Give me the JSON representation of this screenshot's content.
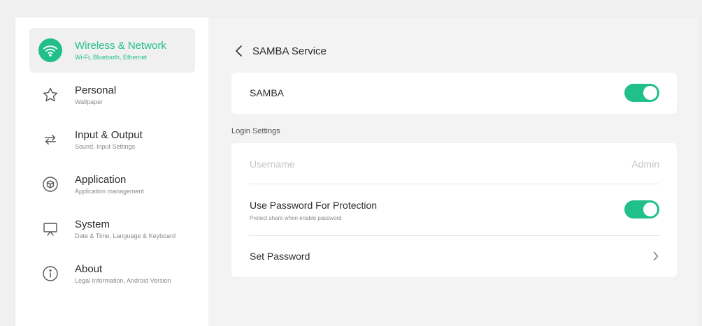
{
  "sidebar": {
    "items": [
      {
        "title": "Wireless & Network",
        "subtitle": "Wi-Fi, Bluetooth, Ethernet",
        "icon": "wifi-icon",
        "active": true
      },
      {
        "title": "Personal",
        "subtitle": "Wallpaper",
        "icon": "star-icon",
        "active": false
      },
      {
        "title": "Input & Output",
        "subtitle": "Sound, Input Settings",
        "icon": "arrows-swap-icon",
        "active": false
      },
      {
        "title": "Application",
        "subtitle": "Application management",
        "icon": "cube-icon",
        "active": false
      },
      {
        "title": "System",
        "subtitle": "Date & Time, Language & Keyboard",
        "icon": "monitor-icon",
        "active": false
      },
      {
        "title": "About",
        "subtitle": "Legal Information, Android Version",
        "icon": "info-icon",
        "active": false
      }
    ]
  },
  "header": {
    "title": "SAMBA Service"
  },
  "samba": {
    "label": "SAMBA",
    "enabled": true
  },
  "login_settings": {
    "section_label": "Login Settings",
    "username_label": "Username",
    "username_value": "Admin",
    "password_protection_label": "Use Password For Protection",
    "password_protection_sub": "Protect share when enable password",
    "password_protection_enabled": true,
    "set_password_label": "Set Password"
  },
  "colors": {
    "accent": "#21c08b",
    "background": "#f3f3f3",
    "card": "#ffffff"
  }
}
